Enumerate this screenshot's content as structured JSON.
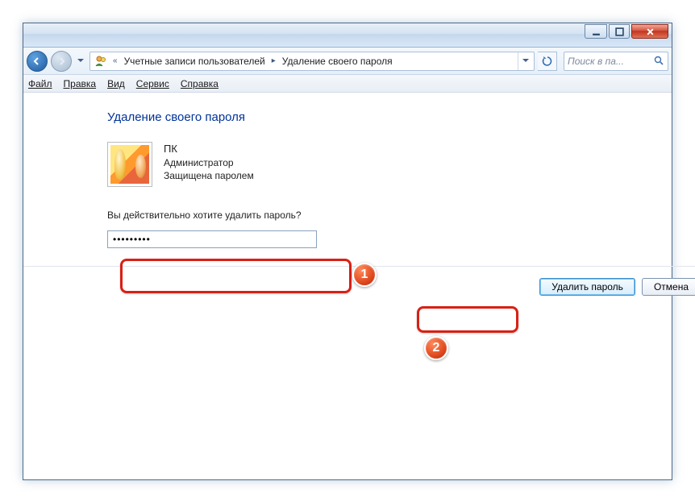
{
  "breadcrumb": {
    "prefix_chevron": "«",
    "segment1": "Учетные записи пользователей",
    "segment2": "Удаление своего пароля"
  },
  "search": {
    "placeholder": "Поиск в па..."
  },
  "menu": {
    "file": "Файл",
    "edit": "Правка",
    "view": "Вид",
    "tools": "Сервис",
    "help": "Справка"
  },
  "heading": "Удаление своего пароля",
  "user": {
    "name": "ПК",
    "role": "Администратор",
    "status": "Защищена паролем"
  },
  "prompt": "Вы действительно хотите удалить пароль?",
  "password_mask": "•••••••••",
  "buttons": {
    "remove": "Удалить пароль",
    "cancel": "Отмена"
  },
  "annotations": {
    "badge1": "1",
    "badge2": "2"
  }
}
